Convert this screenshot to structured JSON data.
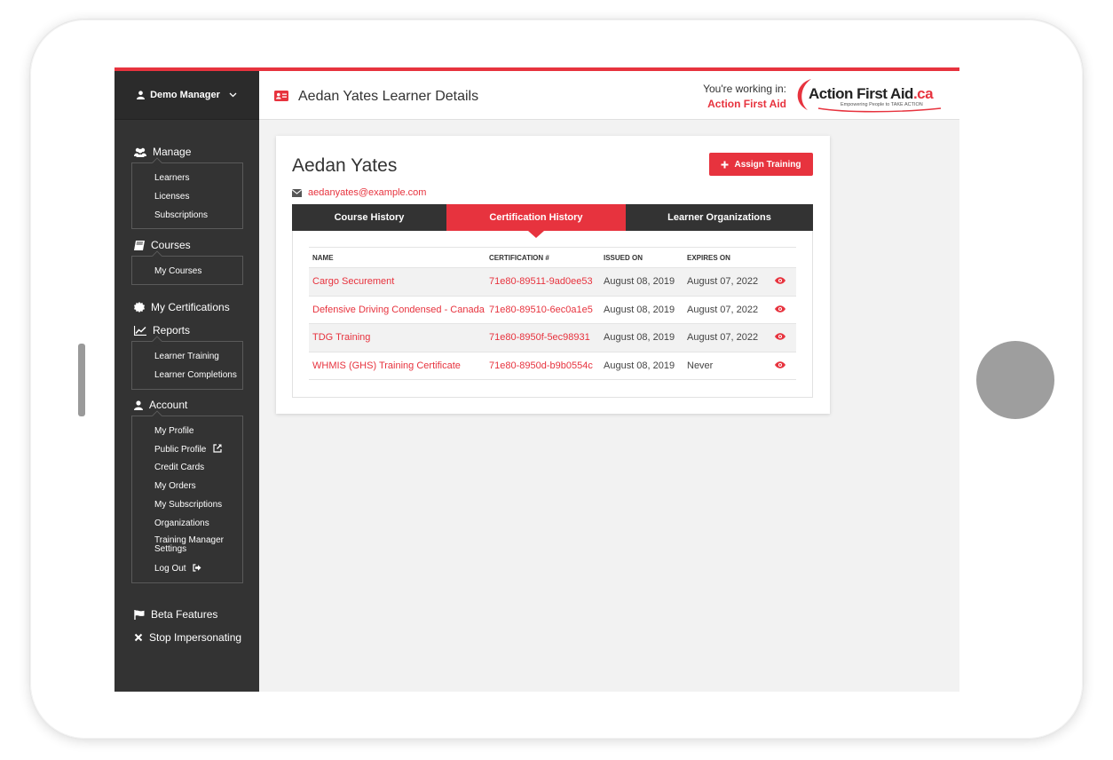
{
  "user": {
    "name": "Demo Manager"
  },
  "sidebar": {
    "manage": {
      "label": "Manage",
      "items": [
        "Learners",
        "Licenses",
        "Subscriptions"
      ]
    },
    "courses": {
      "label": "Courses",
      "items": [
        "My Courses"
      ]
    },
    "certifications": {
      "label": "My Certifications"
    },
    "reports": {
      "label": "Reports",
      "items": [
        "Learner Training",
        "Learner Completions"
      ]
    },
    "account": {
      "label": "Account",
      "items": [
        "My Profile",
        "Public Profile",
        "Credit Cards",
        "My Orders",
        "My Subscriptions",
        "Organizations",
        "Training Manager Settings",
        "Log Out"
      ]
    },
    "beta": {
      "label": "Beta Features"
    },
    "stop": {
      "label": "Stop Impersonating"
    }
  },
  "header": {
    "title": "Aedan Yates Learner Details",
    "working_label": "You're working in:",
    "working_org": "Action First Aid",
    "logo_text": "Action First Aid",
    "logo_suffix": ".ca",
    "logo_tagline": "Empowering People to TAKE ACTION"
  },
  "learner": {
    "name": "Aedan Yates",
    "email": "aedanyates@example.com",
    "assign_label": "Assign Training"
  },
  "tabs": [
    "Course History",
    "Certification History",
    "Learner Organizations"
  ],
  "active_tab": "Certification History",
  "table": {
    "headers": [
      "NAME",
      "CERTIFICATION #",
      "ISSUED ON",
      "EXPIRES ON"
    ],
    "rows": [
      {
        "name": "Cargo Securement",
        "cert": "71e80-89511-9ad0ee53",
        "issued": "August 08, 2019",
        "expires": "August 07, 2022"
      },
      {
        "name": "Defensive Driving Condensed - Canada",
        "cert": "71e80-89510-6ec0a1e5",
        "issued": "August 08, 2019",
        "expires": "August 07, 2022"
      },
      {
        "name": "TDG Training",
        "cert": "71e80-8950f-5ec98931",
        "issued": "August 08, 2019",
        "expires": "August 07, 2022"
      },
      {
        "name": "WHMIS (GHS) Training Certificate",
        "cert": "71e80-8950d-b9b0554c",
        "issued": "August 08, 2019",
        "expires": "Never"
      }
    ]
  },
  "colors": {
    "accent": "#e7333e",
    "sidebar": "#333333",
    "background": "#f2f2f2"
  }
}
